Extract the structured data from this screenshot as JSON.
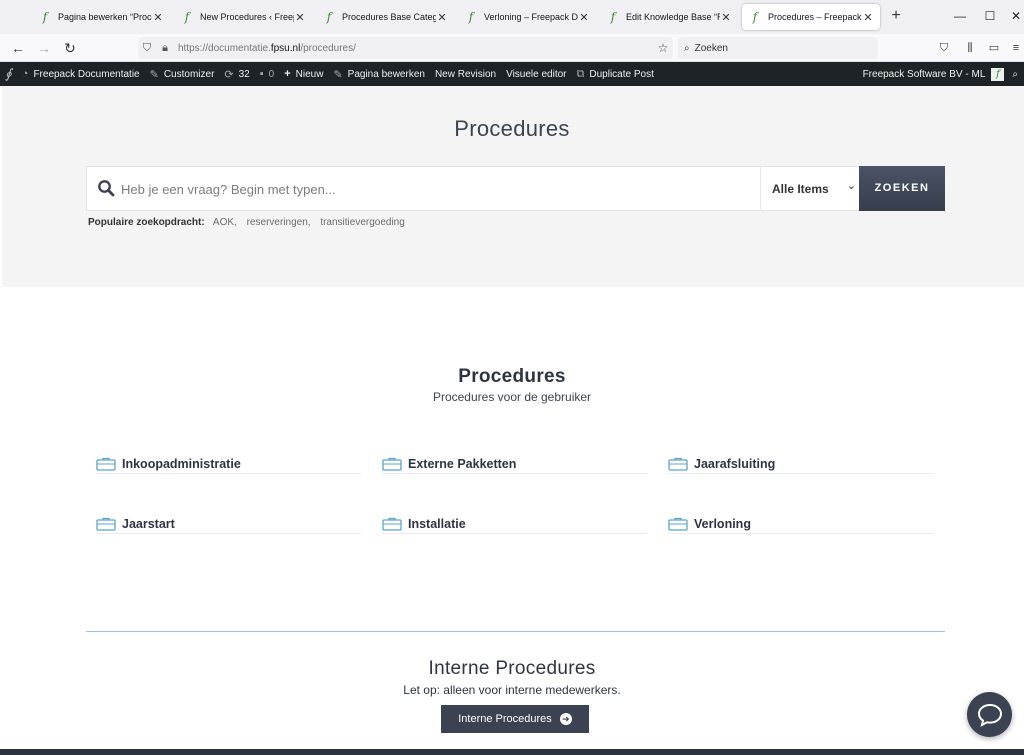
{
  "browser": {
    "tabs": [
      {
        "label": "Pagina bewerken “Procedures"
      },
      {
        "label": "New Procedures ‹ Freepack"
      },
      {
        "label": "Procedures Base Categories"
      },
      {
        "label": "Verloning – Freepack Documentatie"
      },
      {
        "label": "Edit Knowledge Base “Regels"
      },
      {
        "label": "Procedures – Freepack Documentatie"
      }
    ],
    "new_tab": "+",
    "url_prefix": "https://documentatie.",
    "url_domain": "fpsu.nl",
    "url_path": "/procedures/",
    "search_placeholder": "Zoeken",
    "accent_favicon": "#3a8a2e"
  },
  "adminbar": {
    "site_name": "Freepack Documentatie",
    "customizer": "Customizer",
    "updates": "32",
    "comments": "0",
    "new": "Nieuw",
    "edit_page": "Pagina bewerken",
    "new_revision": "New Revision",
    "visual_editor": "Visuele editor",
    "duplicate_post": "Duplicate Post",
    "account": "Freepack Software BV - ML"
  },
  "hero": {
    "title": "Procedures",
    "search_placeholder": "Heb je een vraag? Begin met typen...",
    "select_value": "Alle Items",
    "search_button": "ZOEKEN",
    "popular_label": "Populaire zoekopdracht:",
    "popular_tags": [
      "AOK,",
      "reserveringen,",
      "transitievergoeding"
    ]
  },
  "section": {
    "title": "Procedures",
    "subtitle": "Procedures voor de gebruiker",
    "categories": [
      {
        "label": "Inkoopadministratie"
      },
      {
        "label": "Externe Pakketten"
      },
      {
        "label": "Jaarafsluiting"
      },
      {
        "label": "Jaarstart"
      },
      {
        "label": "Installatie"
      },
      {
        "label": "Verloning"
      }
    ]
  },
  "internal": {
    "title": "Interne Procedures",
    "subtitle": "Let op: alleen voor interne medewerkers.",
    "button": "Interne Procedures"
  },
  "colors": {
    "primary": "#3b4252",
    "icon_accent": "#5ba4c9",
    "admin_bar": "#1d2327"
  }
}
